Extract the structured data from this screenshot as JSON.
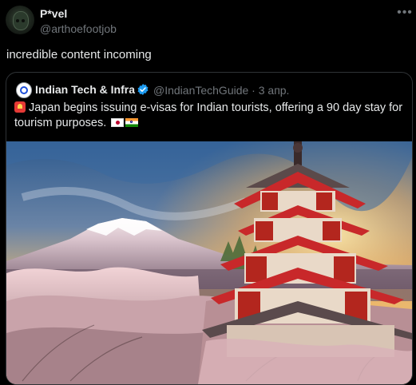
{
  "post": {
    "author_name": "P*vel",
    "author_handle": "@arthoefootjob",
    "more_icon": "more-horizontal-icon",
    "text": "incredible content incoming"
  },
  "quote": {
    "author_name": "Indian Tech & Infra",
    "verified_icon": "verified-badge-icon",
    "author_handle_time": "@IndianTechGuide · 3 апр.",
    "text": "Japan begins issuing e-visas for Indian tourists, offering a 90 day stay for tourism purposes.",
    "icons": [
      "siren-icon",
      "japan-flag-icon",
      "india-flag-icon"
    ],
    "image": "photo-pagoda-mount-fuji"
  },
  "colors": {
    "background": "#000000",
    "text_primary": "#e7e9ea",
    "text_secondary": "#71767b",
    "border": "#2f3336",
    "verified_blue": "#1d9bf0"
  }
}
